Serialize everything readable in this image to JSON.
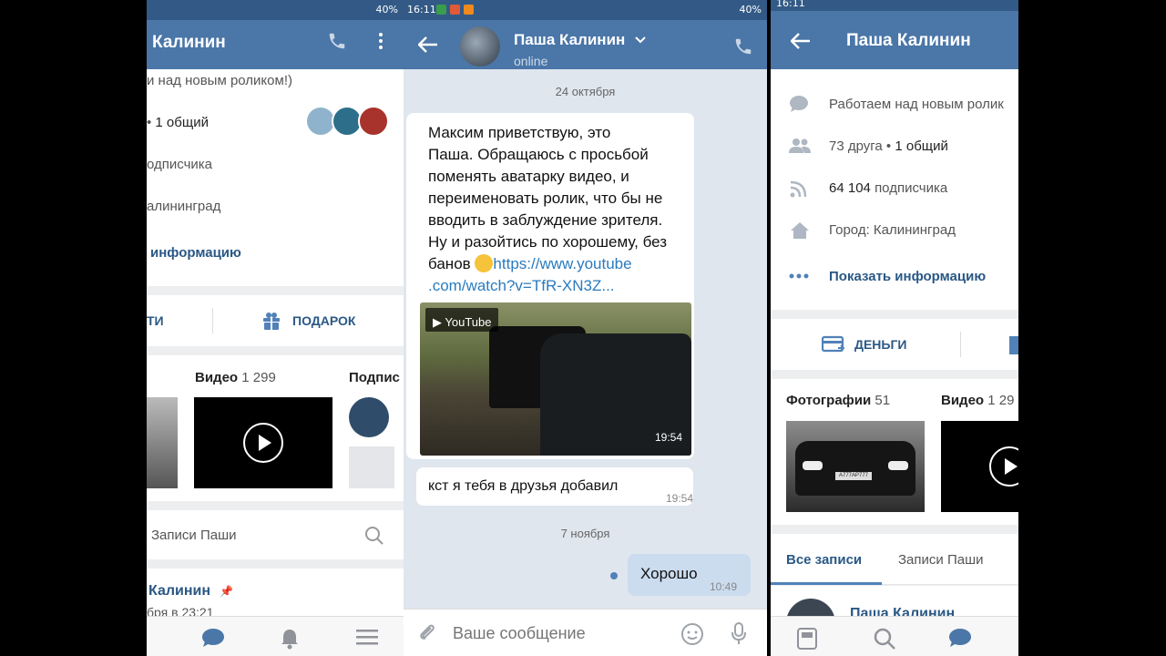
{
  "left": {
    "title": "Калинин",
    "status_line": "и над новым роликом!)",
    "friends": "1 общий",
    "subscribers": "одписчика",
    "city": "алининград",
    "show_info": "информацию",
    "btn_left": "ТИ",
    "gift": "ПОДАРОК",
    "video_label": "Видео",
    "video_count": "1 299",
    "subs_label": "Подпис",
    "posts_tab": "Записи Паши",
    "post_author": "Калинин",
    "post_time": "бря в 23:21"
  },
  "chat": {
    "status_time": "16:11",
    "battery": "40%",
    "contact_name": "Паша Калинин",
    "contact_status": "online",
    "date1": "24 октября",
    "msg1_lines": [
      "Максим приветствую, это",
      "Паша. Обращаюсь с просьбой",
      "поменять аватарку видео, и",
      "переименовать ролик, что бы не",
      "вводить в заблуждение зрителя.",
      "Ну и разойтись по хорошему, без"
    ],
    "msg1_last": "банов",
    "msg1_link1": "https://www.youtube",
    "msg1_link2": ".com/watch?v=TfR-XN3Z...",
    "youtube_label": "YouTube",
    "video_duration": "19:54",
    "msg2": "кст я тебя в друзья добавил",
    "msg2_time": "19:54",
    "date2": "7 ноября",
    "msg3": "Хорошо",
    "msg3_time": "10:49",
    "input_placeholder": "Ваше сообщение"
  },
  "right": {
    "status_time": "16:11",
    "title": "Паша Калинин",
    "status_line": "Работаем над новым ролик",
    "friends_count": "73 друга",
    "friends_common": "1 общий",
    "subs_count": "64 104",
    "subs_word": "подписчика",
    "city": "Город: Калининград",
    "show_info": "Показать информацию",
    "money": "ДЕНЬГИ",
    "photos_label": "Фотографии",
    "photos_count": "51",
    "video_label": "Видео",
    "video_count": "1 29",
    "plate": "А777АР777",
    "tab_all": "Все записи",
    "tab_pasha": "Записи Паши",
    "post_author": "Паша Калинин"
  },
  "colors": {
    "header": "#4a76a8",
    "status": "#335a86",
    "link": "#2a5885",
    "bg": "#edeef0"
  }
}
